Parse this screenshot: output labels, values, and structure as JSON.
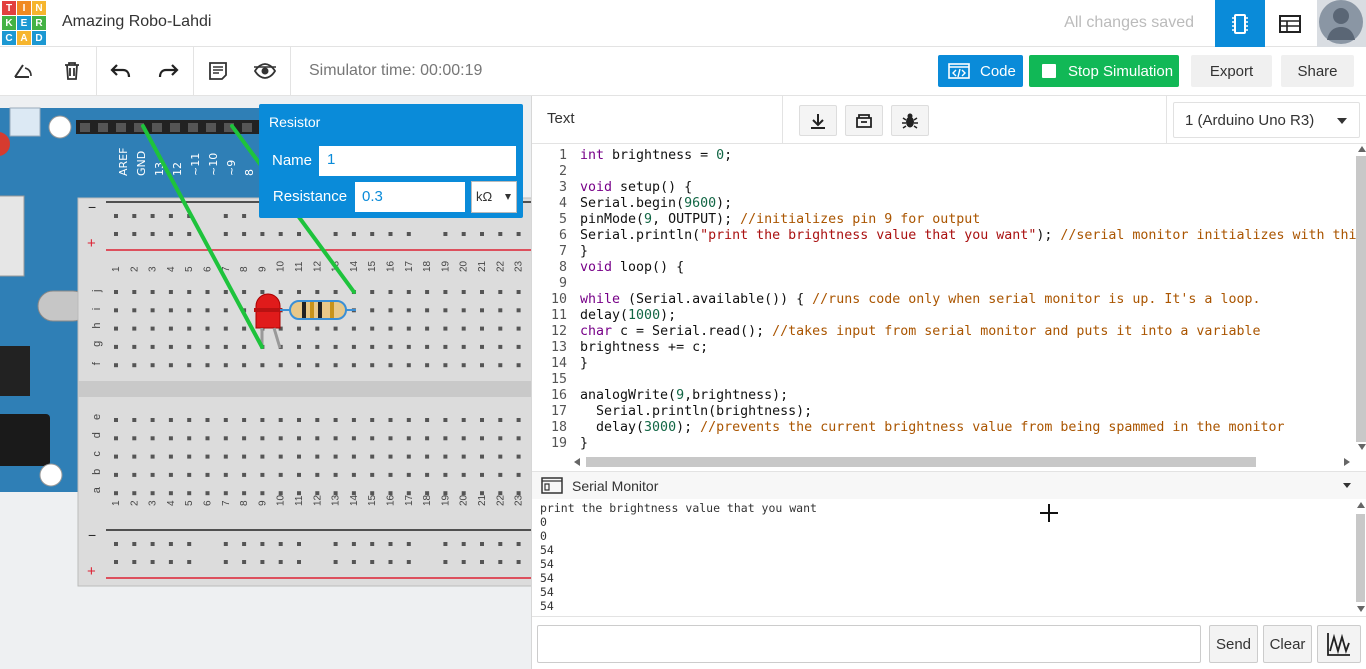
{
  "app": {
    "logo_letters": [
      "T",
      "I",
      "N",
      "K",
      "E",
      "R",
      "C",
      "A",
      "D"
    ],
    "logo_colors": [
      "#e2403f",
      "#f08a22",
      "#f6b52e",
      "#43b244",
      "#1c98d2",
      "#43b244",
      "#1c98d2",
      "#f6b52e",
      "#1c98d2"
    ],
    "project_title": "Amazing Robo-Lahdi",
    "save_status": "All changes saved",
    "accent_color": "#0a8bd9"
  },
  "toolbar": {
    "sim_time": "Simulator time: 00:00:19",
    "code_label": "Code",
    "stop_label": "Stop Simulation",
    "export_label": "Export",
    "share_label": "Share"
  },
  "resistor_panel": {
    "title": "Resistor",
    "name_label": "Name",
    "name_value": "1",
    "resistance_label": "Resistance",
    "resistance_value": "0.3",
    "unit": "kΩ"
  },
  "arduino": {
    "pin_labels": [
      "AREF",
      "GND",
      "13",
      "12",
      "~11",
      "~10",
      "~9",
      "8"
    ]
  },
  "breadboard": {
    "columns": [
      "1",
      "2",
      "3",
      "4",
      "5",
      "6",
      "7",
      "8",
      "9",
      "10",
      "11",
      "12",
      "13",
      "14",
      "15",
      "16",
      "17",
      "18",
      "19",
      "20",
      "21",
      "22",
      "23"
    ],
    "upper_rows": [
      "j",
      "i",
      "h",
      "g",
      "f"
    ],
    "lower_rows": [
      "e",
      "d",
      "c",
      "b",
      "a"
    ],
    "rail_minus": "−",
    "rail_plus": "+"
  },
  "code_panel": {
    "mode": "Text",
    "device": "1 (Arduino Uno R3)",
    "lines": [
      [
        [
          "int",
          "k"
        ],
        [
          " brightness = ",
          ""
        ],
        [
          "0",
          "n"
        ],
        [
          ";",
          ""
        ]
      ],
      [],
      [
        [
          "void",
          "k"
        ],
        [
          " setup() {",
          ""
        ]
      ],
      [
        [
          "Serial.begin(",
          ""
        ],
        [
          "9600",
          "n"
        ],
        [
          ");",
          ""
        ]
      ],
      [
        [
          "pinMode(",
          ""
        ],
        [
          "9",
          "n"
        ],
        [
          ", OUTPUT); ",
          ""
        ],
        [
          "//initializes pin 9 for output",
          "c"
        ]
      ],
      [
        [
          "Serial.println(",
          ""
        ],
        [
          "\"print the brightness value that you want\"",
          "s"
        ],
        [
          "); ",
          ""
        ],
        [
          "//serial monitor initializes with this message",
          "c"
        ]
      ],
      [
        [
          "}",
          ""
        ]
      ],
      [
        [
          "void",
          "k"
        ],
        [
          " loop() {",
          ""
        ]
      ],
      [],
      [
        [
          "while",
          "k"
        ],
        [
          " (Serial.available()) { ",
          ""
        ],
        [
          "//runs code only when serial monitor is up. It's a loop.",
          "c"
        ]
      ],
      [
        [
          "delay(",
          ""
        ],
        [
          "1000",
          "n"
        ],
        [
          ");",
          ""
        ]
      ],
      [
        [
          "char",
          "k"
        ],
        [
          " c = Serial.read(); ",
          ""
        ],
        [
          "//takes input from serial monitor and puts it into a variable",
          "c"
        ]
      ],
      [
        [
          "brightness += c;",
          ""
        ]
      ],
      [
        [
          "}",
          ""
        ]
      ],
      [],
      [
        [
          "analogWrite(",
          ""
        ],
        [
          "9",
          "n"
        ],
        [
          ",brightness);",
          ""
        ]
      ],
      [
        [
          "  Serial.println(brightness);",
          ""
        ]
      ],
      [
        [
          "  delay(",
          ""
        ],
        [
          "3000",
          "n"
        ],
        [
          "); ",
          ""
        ],
        [
          "//prevents the current brightness value from being spammed in the monitor",
          "c"
        ]
      ],
      [
        [
          "}",
          ""
        ]
      ]
    ]
  },
  "serial_monitor": {
    "title": "Serial Monitor",
    "output": [
      "print the brightness value that you want",
      "0",
      "0",
      "54",
      "54",
      "54",
      "54",
      "54"
    ],
    "send_label": "Send",
    "clear_label": "Clear"
  }
}
